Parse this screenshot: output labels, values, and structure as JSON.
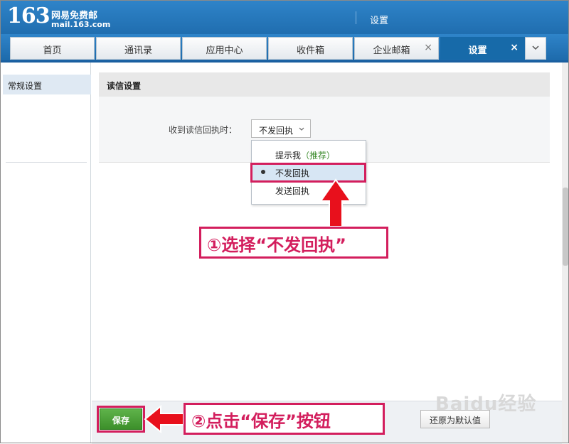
{
  "app": {
    "logo_number": "163",
    "logo_cn": "网易免费邮",
    "logo_domain": "mail.163.com",
    "header_title": "设置"
  },
  "tabs": [
    {
      "label": "首页",
      "closable": false,
      "active": false
    },
    {
      "label": "通讯录",
      "closable": false,
      "active": false
    },
    {
      "label": "应用中心",
      "closable": false,
      "active": false
    },
    {
      "label": "收件箱",
      "closable": false,
      "active": false
    },
    {
      "label": "企业邮箱",
      "closable": true,
      "active": false
    },
    {
      "label": "设置",
      "closable": true,
      "active": true
    }
  ],
  "tab_close_glyph": "×",
  "sidebar": {
    "items": [
      {
        "label": "常规设置",
        "selected": true
      }
    ]
  },
  "main": {
    "section_title": "读信设置",
    "field_label": "收到读信回执时：",
    "select_value": "不发回执",
    "dropdown": [
      {
        "label": "提示我",
        "tag": "（推荐）",
        "selected": false
      },
      {
        "label": "不发回执",
        "tag": "",
        "selected": true
      },
      {
        "label": "发送回执",
        "tag": "",
        "selected": false
      }
    ]
  },
  "footer": {
    "save_label": "保存",
    "reset_label": "还原为默认值"
  },
  "annotations": {
    "step1": "①选择“不发回执”",
    "step2": "②点击“保存”按钮"
  },
  "watermark": "Baidu经验",
  "colors": {
    "brand_blue": "#1d6aab",
    "annotation_red": "#d31e5d",
    "save_green": "#3c8f2a",
    "recommend_green": "#3a8a2a"
  }
}
